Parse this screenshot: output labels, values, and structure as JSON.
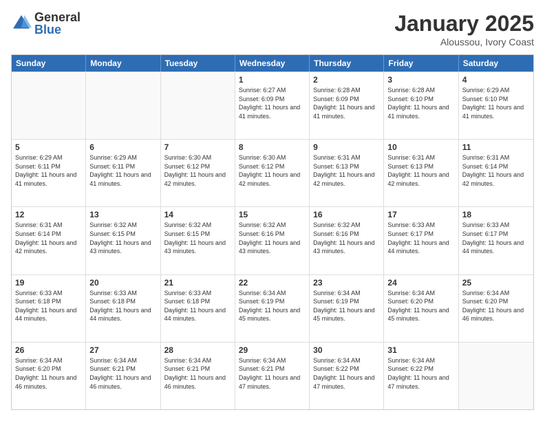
{
  "header": {
    "logo": {
      "general": "General",
      "blue": "Blue"
    },
    "title": "January 2025",
    "subtitle": "Aloussou, Ivory Coast"
  },
  "days": [
    "Sunday",
    "Monday",
    "Tuesday",
    "Wednesday",
    "Thursday",
    "Friday",
    "Saturday"
  ],
  "rows": [
    [
      {
        "day": "",
        "info": ""
      },
      {
        "day": "",
        "info": ""
      },
      {
        "day": "",
        "info": ""
      },
      {
        "day": "1",
        "info": "Sunrise: 6:27 AM\nSunset: 6:09 PM\nDaylight: 11 hours and 41 minutes."
      },
      {
        "day": "2",
        "info": "Sunrise: 6:28 AM\nSunset: 6:09 PM\nDaylight: 11 hours and 41 minutes."
      },
      {
        "day": "3",
        "info": "Sunrise: 6:28 AM\nSunset: 6:10 PM\nDaylight: 11 hours and 41 minutes."
      },
      {
        "day": "4",
        "info": "Sunrise: 6:29 AM\nSunset: 6:10 PM\nDaylight: 11 hours and 41 minutes."
      }
    ],
    [
      {
        "day": "5",
        "info": "Sunrise: 6:29 AM\nSunset: 6:11 PM\nDaylight: 11 hours and 41 minutes."
      },
      {
        "day": "6",
        "info": "Sunrise: 6:29 AM\nSunset: 6:11 PM\nDaylight: 11 hours and 41 minutes."
      },
      {
        "day": "7",
        "info": "Sunrise: 6:30 AM\nSunset: 6:12 PM\nDaylight: 11 hours and 42 minutes."
      },
      {
        "day": "8",
        "info": "Sunrise: 6:30 AM\nSunset: 6:12 PM\nDaylight: 11 hours and 42 minutes."
      },
      {
        "day": "9",
        "info": "Sunrise: 6:31 AM\nSunset: 6:13 PM\nDaylight: 11 hours and 42 minutes."
      },
      {
        "day": "10",
        "info": "Sunrise: 6:31 AM\nSunset: 6:13 PM\nDaylight: 11 hours and 42 minutes."
      },
      {
        "day": "11",
        "info": "Sunrise: 6:31 AM\nSunset: 6:14 PM\nDaylight: 11 hours and 42 minutes."
      }
    ],
    [
      {
        "day": "12",
        "info": "Sunrise: 6:31 AM\nSunset: 6:14 PM\nDaylight: 11 hours and 42 minutes."
      },
      {
        "day": "13",
        "info": "Sunrise: 6:32 AM\nSunset: 6:15 PM\nDaylight: 11 hours and 43 minutes."
      },
      {
        "day": "14",
        "info": "Sunrise: 6:32 AM\nSunset: 6:15 PM\nDaylight: 11 hours and 43 minutes."
      },
      {
        "day": "15",
        "info": "Sunrise: 6:32 AM\nSunset: 6:16 PM\nDaylight: 11 hours and 43 minutes."
      },
      {
        "day": "16",
        "info": "Sunrise: 6:32 AM\nSunset: 6:16 PM\nDaylight: 11 hours and 43 minutes."
      },
      {
        "day": "17",
        "info": "Sunrise: 6:33 AM\nSunset: 6:17 PM\nDaylight: 11 hours and 44 minutes."
      },
      {
        "day": "18",
        "info": "Sunrise: 6:33 AM\nSunset: 6:17 PM\nDaylight: 11 hours and 44 minutes."
      }
    ],
    [
      {
        "day": "19",
        "info": "Sunrise: 6:33 AM\nSunset: 6:18 PM\nDaylight: 11 hours and 44 minutes."
      },
      {
        "day": "20",
        "info": "Sunrise: 6:33 AM\nSunset: 6:18 PM\nDaylight: 11 hours and 44 minutes."
      },
      {
        "day": "21",
        "info": "Sunrise: 6:33 AM\nSunset: 6:18 PM\nDaylight: 11 hours and 44 minutes."
      },
      {
        "day": "22",
        "info": "Sunrise: 6:34 AM\nSunset: 6:19 PM\nDaylight: 11 hours and 45 minutes."
      },
      {
        "day": "23",
        "info": "Sunrise: 6:34 AM\nSunset: 6:19 PM\nDaylight: 11 hours and 45 minutes."
      },
      {
        "day": "24",
        "info": "Sunrise: 6:34 AM\nSunset: 6:20 PM\nDaylight: 11 hours and 45 minutes."
      },
      {
        "day": "25",
        "info": "Sunrise: 6:34 AM\nSunset: 6:20 PM\nDaylight: 11 hours and 46 minutes."
      }
    ],
    [
      {
        "day": "26",
        "info": "Sunrise: 6:34 AM\nSunset: 6:20 PM\nDaylight: 11 hours and 46 minutes."
      },
      {
        "day": "27",
        "info": "Sunrise: 6:34 AM\nSunset: 6:21 PM\nDaylight: 11 hours and 46 minutes."
      },
      {
        "day": "28",
        "info": "Sunrise: 6:34 AM\nSunset: 6:21 PM\nDaylight: 11 hours and 46 minutes."
      },
      {
        "day": "29",
        "info": "Sunrise: 6:34 AM\nSunset: 6:21 PM\nDaylight: 11 hours and 47 minutes."
      },
      {
        "day": "30",
        "info": "Sunrise: 6:34 AM\nSunset: 6:22 PM\nDaylight: 11 hours and 47 minutes."
      },
      {
        "day": "31",
        "info": "Sunrise: 6:34 AM\nSunset: 6:22 PM\nDaylight: 11 hours and 47 minutes."
      },
      {
        "day": "",
        "info": ""
      }
    ]
  ]
}
